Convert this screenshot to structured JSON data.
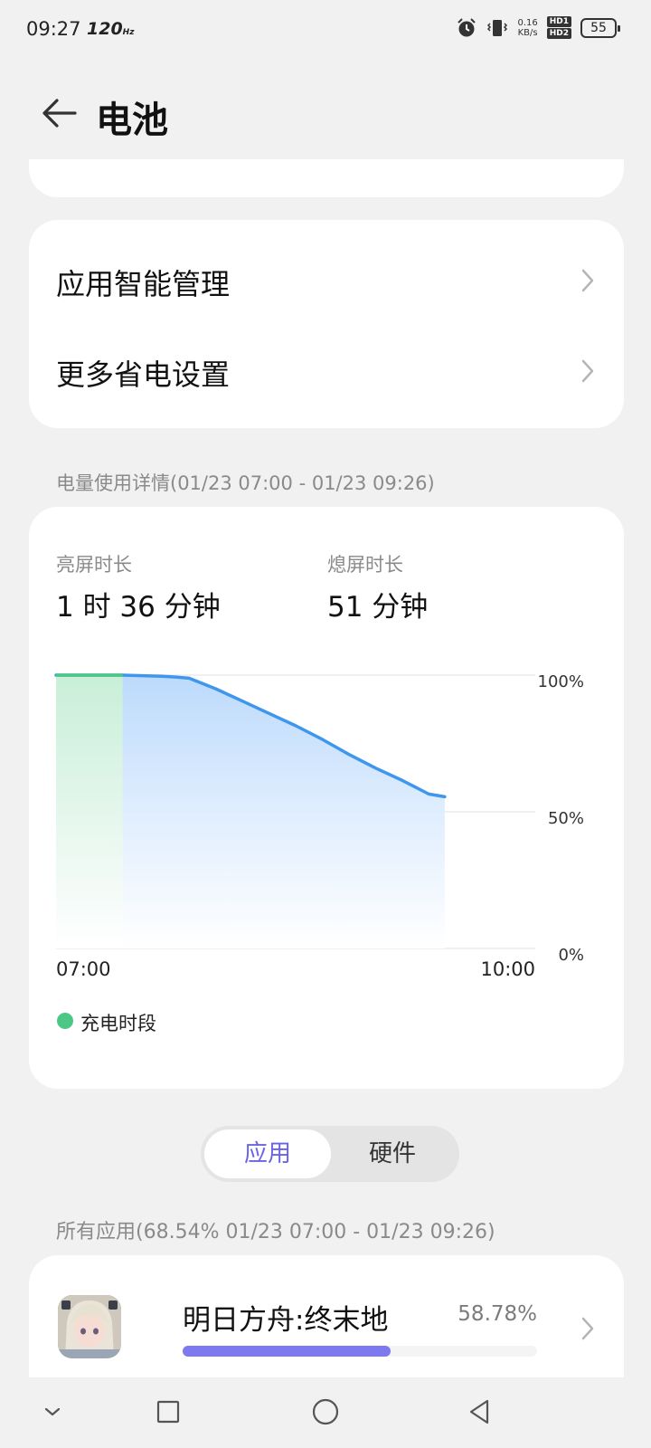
{
  "status_bar": {
    "time": "09:27",
    "refresh_rate": "120",
    "refresh_unit": "Hz",
    "net_speed_value": "0.16",
    "net_speed_unit": "KB/s",
    "hd_top": "HD1",
    "hd_bottom": "HD2",
    "battery_level": "55",
    "icons": [
      "alarm-icon",
      "vibrate-icon",
      "hd-icon",
      "battery-icon"
    ]
  },
  "header": {
    "title": "电池",
    "back_icon": "back-arrow-icon"
  },
  "menu": {
    "items": [
      {
        "label": "应用智能管理",
        "icon": "chevron-right-icon"
      },
      {
        "label": "更多省电设置",
        "icon": "chevron-right-icon"
      }
    ]
  },
  "usage_detail": {
    "section_label": "电量使用详情(01/23 07:00 - 01/23 09:26)",
    "screen_on_label": "亮屏时长",
    "screen_on_value": "1 时 36 分钟",
    "screen_off_label": "熄屏时长",
    "screen_off_value": "51 分钟",
    "legend_label": "充电时段",
    "legend_color": "#4cc784"
  },
  "chart_data": {
    "type": "area",
    "title": "",
    "xlabel": "",
    "ylabel": "",
    "x_ticks": [
      "07:00",
      "10:00"
    ],
    "y_ticks": [
      "100%",
      "50%",
      "0%"
    ],
    "xlim": [
      "07:00",
      "10:00"
    ],
    "ylim": [
      0,
      100
    ],
    "grid": true,
    "line_color": "#3e97ec",
    "fill_color": "#c7e1fd",
    "charging_color": "#4cc784",
    "charging_period": [
      "07:00",
      "07:25"
    ],
    "series": [
      {
        "x": [
          "07:00",
          "07:25",
          "07:40",
          "07:45",
          "07:50",
          "08:00",
          "08:10",
          "08:20",
          "08:30",
          "08:40",
          "08:50",
          "09:00",
          "09:10",
          "09:15",
          "09:20",
          "09:26"
        ],
        "values": [
          100,
          100,
          99.6,
          99.3,
          98.9,
          95,
          90.5,
          86,
          81.5,
          76.5,
          71,
          66,
          61.5,
          59,
          56.5,
          55.5
        ]
      }
    ]
  },
  "tabs": {
    "active": "应用",
    "inactive": "硬件",
    "active_color": "#6b63e6"
  },
  "apps": {
    "section_label": "所有应用(68.54% 01/23 07:00 - 01/23 09:26)",
    "items": [
      {
        "name": "明日方舟:终末地",
        "percent": "58.78%",
        "fraction": 0.5878,
        "bar_color": "#7d79ee",
        "icon": "app-icon-arknights-endfield"
      }
    ]
  },
  "navbar": {
    "icons": [
      "collapse-chevron-icon",
      "recents-square-icon",
      "home-circle-icon",
      "back-triangle-icon"
    ]
  }
}
